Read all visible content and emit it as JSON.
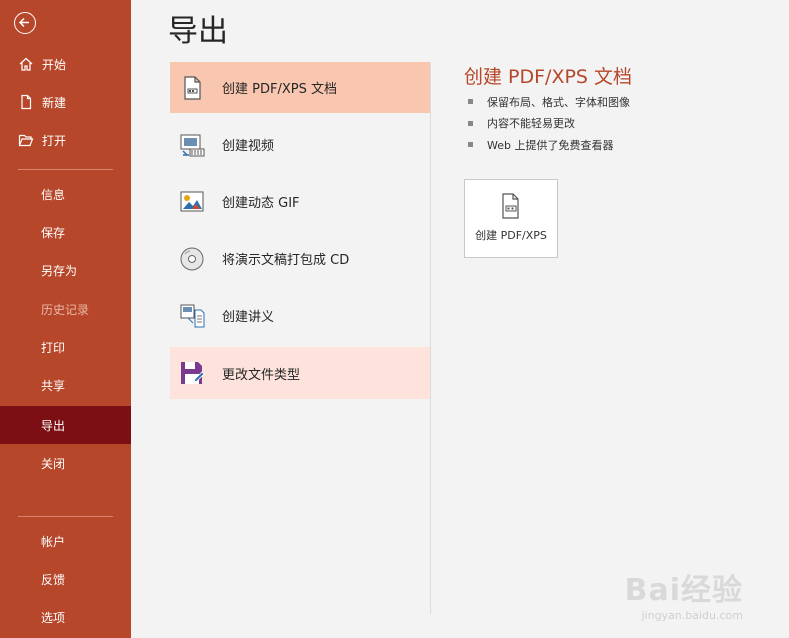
{
  "page": {
    "title": "导出"
  },
  "sidebar": {
    "top_items": [
      {
        "label": "开始",
        "icon": "home-icon"
      },
      {
        "label": "新建",
        "icon": "new-document-icon"
      },
      {
        "label": "打开",
        "icon": "open-folder-icon"
      }
    ],
    "mid_items": [
      {
        "label": "信息"
      },
      {
        "label": "保存"
      },
      {
        "label": "另存为"
      },
      {
        "label": "历史记录",
        "disabled": true
      },
      {
        "label": "打印"
      },
      {
        "label": "共享"
      },
      {
        "label": "导出",
        "active": true
      },
      {
        "label": "关闭"
      }
    ],
    "bottom_items": [
      {
        "label": "帐户"
      },
      {
        "label": "反馈"
      },
      {
        "label": "选项"
      }
    ],
    "colors": {
      "background": "#b7472a",
      "active": "#7b0f14"
    }
  },
  "export_options": [
    {
      "label": "创建 PDF/XPS 文档",
      "icon": "pdf-document-icon",
      "state": "selected"
    },
    {
      "label": "创建视频",
      "icon": "video-icon"
    },
    {
      "label": "创建动态 GIF",
      "icon": "gif-image-icon"
    },
    {
      "label": "将演示文稿打包成 CD",
      "icon": "cd-icon"
    },
    {
      "label": "创建讲义",
      "icon": "handout-icon"
    },
    {
      "label": "更改文件类型",
      "icon": "save-as-type-icon",
      "state": "hover"
    }
  ],
  "detail": {
    "title": "创建 PDF/XPS 文档",
    "bullets": [
      "保留布局、格式、字体和图像",
      "内容不能轻易更改",
      "Web 上提供了免费查看器"
    ],
    "button_label": "创建 PDF/XPS",
    "button_icon": "pdf-document-icon"
  },
  "watermark": {
    "text": "Bai经验",
    "url": "jingyan.baidu.com"
  }
}
